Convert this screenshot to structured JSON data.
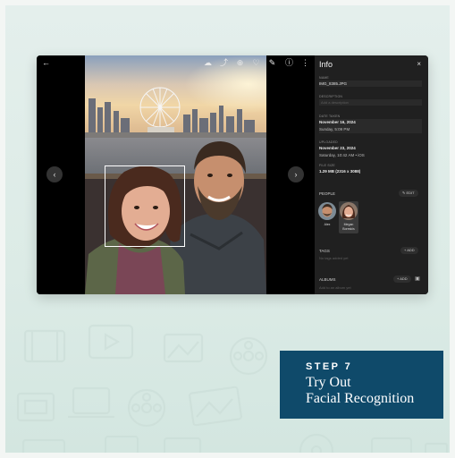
{
  "viewer": {
    "icons": [
      "back-arrow-icon",
      "cloud-icon",
      "share-icon",
      "zoom-icon",
      "favorite-heart-icon",
      "edit-icon",
      "info-icon",
      "more-vertical-icon"
    ],
    "prev_icon": "‹",
    "next_icon": "›"
  },
  "info_panel": {
    "title": "Info",
    "close_icon": "×",
    "name_label": "NAME",
    "name_value": "IMG_8385.JPG",
    "description_label": "DESCRIPTION",
    "description_placeholder": "Add a description",
    "date_taken_label": "DATE TAKEN",
    "date_taken_value": "November 16, 2024",
    "date_taken_time": "Sunday, 5:09 PM",
    "uploaded_label": "UPLOADED",
    "uploaded_value": "November 23, 2024",
    "uploaded_time": "Saturday, 10:42 AM • iOS",
    "file_size_label": "FILE SIZE",
    "file_size_value": "1.29 MB (2316 x 3088)",
    "people_label": "PEOPLE",
    "people_edit": "✎ EDIT",
    "people": [
      {
        "name": "Alex"
      },
      {
        "name": "Megan Boreskis"
      }
    ],
    "tags_label": "TAGS",
    "tags_add": "+ ADD",
    "tags_placeholder": "No tags added yet",
    "albums_label": "ALBUMS",
    "albums_add": "+ ADD",
    "albums_placeholder": "Add to an album yet"
  },
  "step": {
    "label": "STEP 7",
    "title_line1": "Try Out",
    "title_line2": "Facial Recognition"
  },
  "colors": {
    "accent_card": "#0f4a6a",
    "panel_bg": "#202020",
    "page_bg": "#e2eeea"
  }
}
